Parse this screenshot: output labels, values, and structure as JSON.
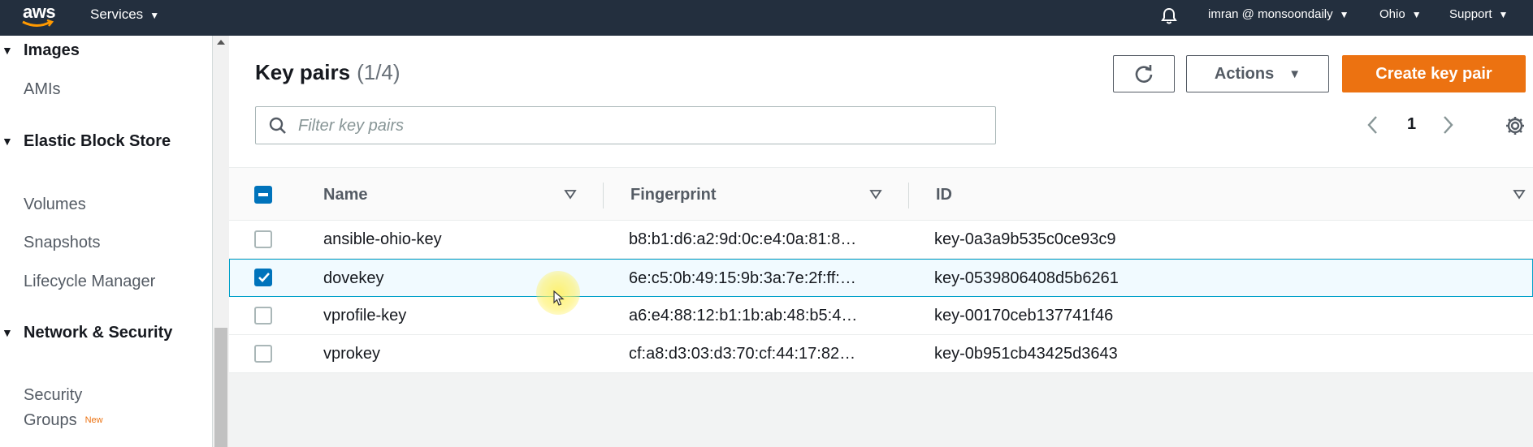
{
  "topnav": {
    "logo_text": "aws",
    "services_label": "Services",
    "user_label": "imran @ monsoondaily",
    "region_label": "Ohio",
    "support_label": "Support"
  },
  "sidebar": {
    "sections": [
      {
        "label": "Images",
        "items": [
          "AMIs"
        ]
      },
      {
        "label": "Elastic Block Store",
        "items": [
          "Volumes",
          "Snapshots",
          "Lifecycle Manager"
        ]
      },
      {
        "label": "Network & Security",
        "items": [
          "Security Groups"
        ]
      }
    ],
    "new_badge": "New"
  },
  "page": {
    "title": "Key pairs",
    "count": "(1/4)",
    "actions_label": "Actions",
    "create_label": "Create key pair",
    "filter_placeholder": "Filter key pairs",
    "filter_value": "",
    "current_page": "1"
  },
  "table": {
    "columns": [
      "Name",
      "Fingerprint",
      "ID"
    ],
    "rows": [
      {
        "name": "ansible-ohio-key",
        "fingerprint": "b8:b1:d6:a2:9d:0c:e4:0a:81:8…",
        "id": "key-0a3a9b535c0ce93c9",
        "selected": false
      },
      {
        "name": "dovekey",
        "fingerprint": "6e:c5:0b:49:15:9b:3a:7e:2f:ff:…",
        "id": "key-0539806408d5b6261",
        "selected": true
      },
      {
        "name": "vprofile-key",
        "fingerprint": "a6:e4:88:12:b1:1b:ab:48:b5:4…",
        "id": "key-00170ceb137741f46",
        "selected": false
      },
      {
        "name": "vprokey",
        "fingerprint": "cf:a8:d3:03:d3:70:cf:44:17:82…",
        "id": "key-0b951cb43425d3643",
        "selected": false
      }
    ]
  },
  "colors": {
    "nav_bg": "#232f3e",
    "primary_button": "#ec7211",
    "checkbox_checked": "#0073bb",
    "selected_row_border": "#00a1c9"
  }
}
